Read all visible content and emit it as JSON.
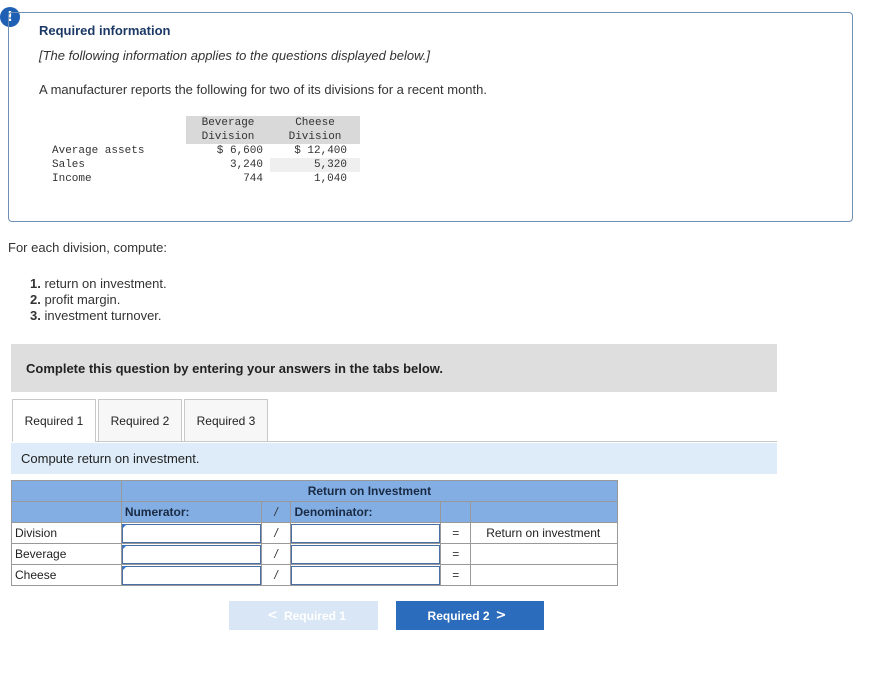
{
  "alert": {
    "icon": "exclamation-icon",
    "symbol": "!"
  },
  "info": {
    "title": "Required information",
    "subtitle": "[The following information applies to the questions displayed below.]",
    "description": "A manufacturer reports the following for two of its divisions for a recent month.",
    "table": {
      "col1_line1": "Beverage",
      "col1_line2": "Division",
      "col2_line1": "Cheese",
      "col2_line2": "Division",
      "rows": [
        {
          "label": "Average assets",
          "beverage": "$ 6,600",
          "cheese": "$ 12,400"
        },
        {
          "label": "Sales",
          "beverage": "3,240",
          "cheese": "5,320"
        },
        {
          "label": "Income",
          "beverage": "744",
          "cheese": "1,040"
        }
      ]
    }
  },
  "instructions": {
    "intro": "For each division, compute:",
    "tasks": [
      {
        "num": "1.",
        "text": "return on investment."
      },
      {
        "num": "2.",
        "text": "profit margin."
      },
      {
        "num": "3.",
        "text": "investment turnover."
      }
    ]
  },
  "complete_bar": "Complete this question by entering your answers in the tabs below.",
  "tabs": [
    {
      "label": "Required 1",
      "active": true
    },
    {
      "label": "Required 2",
      "active": false
    },
    {
      "label": "Required 3",
      "active": false
    }
  ],
  "tab_prompt": "Compute return on investment.",
  "roi_table": {
    "title": "Return on Investment",
    "numerator_label": "Numerator:",
    "slash": "/",
    "denominator_label": "Denominator:",
    "equals": "=",
    "header_label": "Division",
    "result_label": "Return on investment",
    "rows": [
      {
        "label": "Beverage"
      },
      {
        "label": "Cheese"
      }
    ],
    "inputs": {
      "numerator_value": "",
      "denominator_value": ""
    }
  },
  "nav": {
    "prev_label": "Required 1",
    "next_label": "Required 2",
    "prev_chevron": "<",
    "next_chevron": ">"
  },
  "colors": {
    "accent": "#2c6cbd",
    "table_header": "#82aee3",
    "prompt_bg": "#ddecf8"
  }
}
